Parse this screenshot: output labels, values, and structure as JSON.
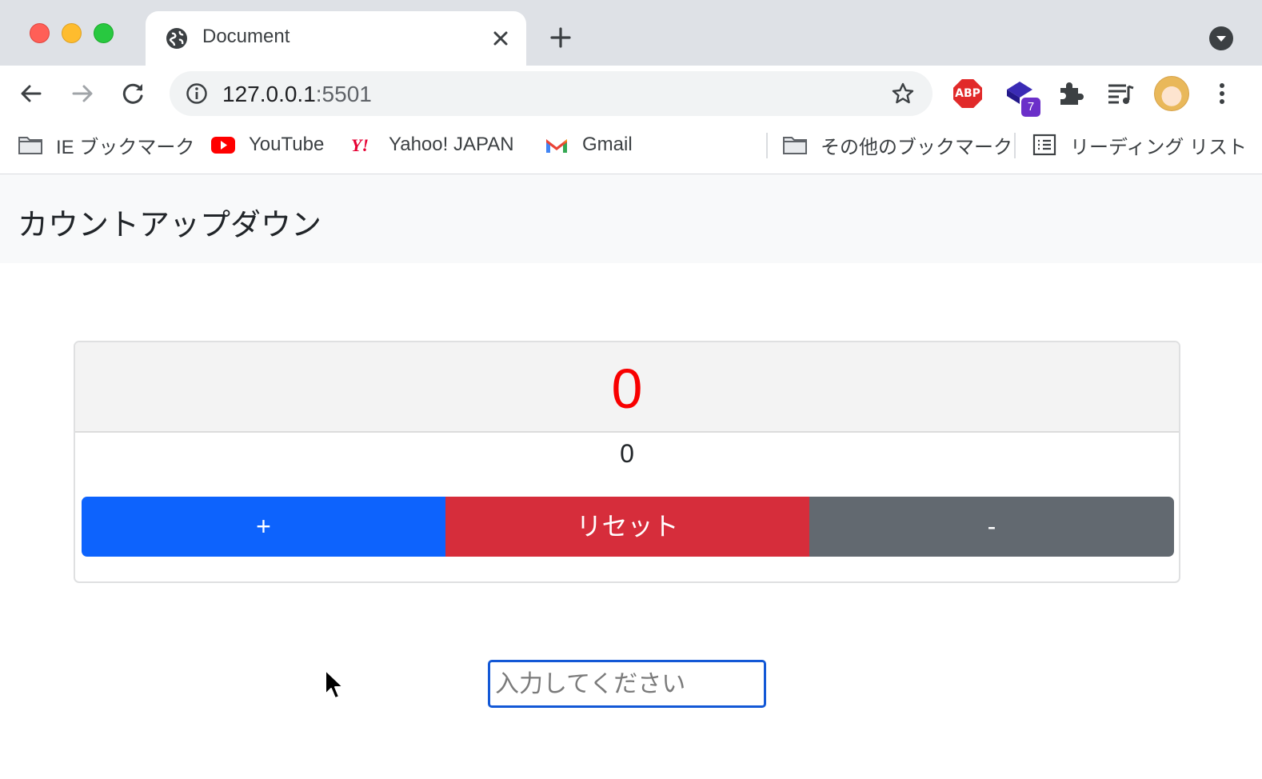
{
  "browser": {
    "tab_title": "Document",
    "url_host": "127.0.0.1",
    "url_port": ":5501",
    "extension_badge": "7",
    "abp_label": "ABP",
    "bookmarks": [
      {
        "label": "IE ブックマーク",
        "icon": "folder-icon"
      },
      {
        "label": "YouTube",
        "icon": "youtube-icon"
      },
      {
        "label": "Yahoo! JAPAN",
        "icon": "yahoo-icon"
      },
      {
        "label": "Gmail",
        "icon": "gmail-icon"
      }
    ],
    "other_bookmarks": "その他のブックマーク",
    "reading_list": "リーディング リスト"
  },
  "page": {
    "brand": "カウントアップダウン",
    "count_display": "0",
    "count_value": "0",
    "buttons": {
      "plus": "+",
      "reset": "リセット",
      "minus": "-"
    },
    "input": {
      "value": "",
      "placeholder": "入力してください"
    }
  },
  "colors": {
    "count": "#f80000",
    "plus": "#0d63fd",
    "reset": "#d62d3b",
    "minus": "#626970"
  }
}
